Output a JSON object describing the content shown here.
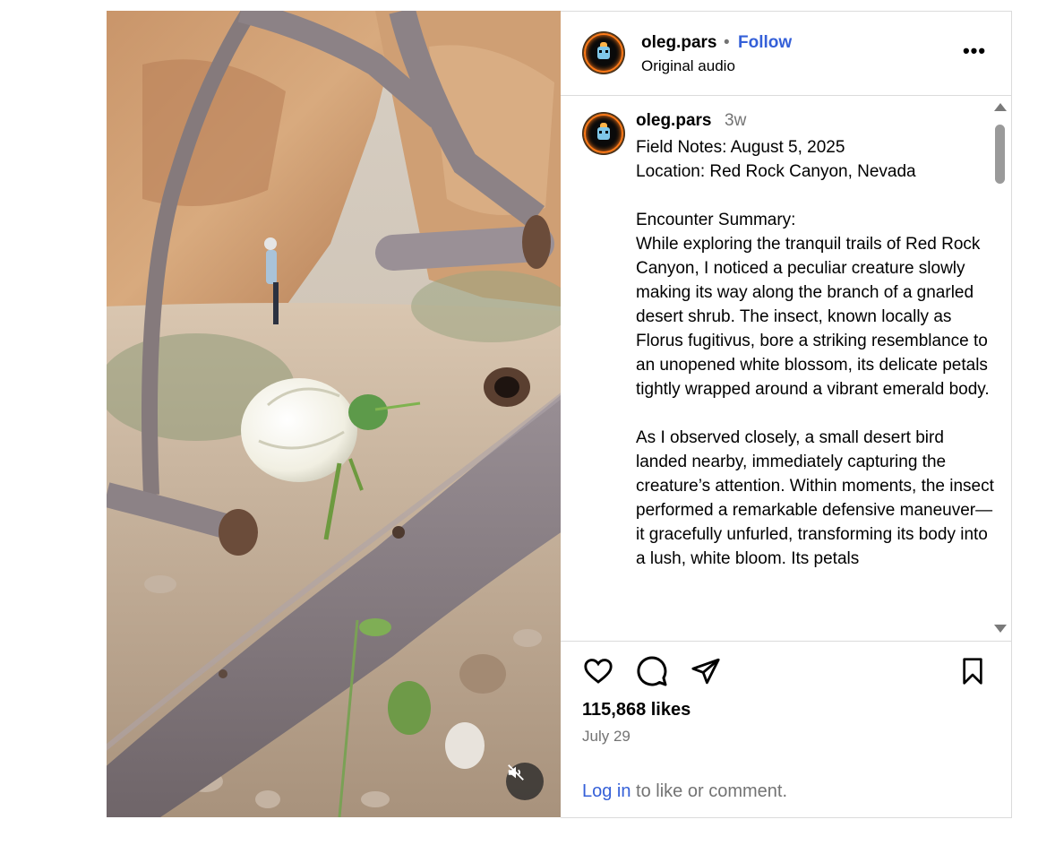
{
  "post": {
    "author": "oleg.pars",
    "separator": "•",
    "follow_label": "Follow",
    "audio_label": "Original audio",
    "more_label": "•••",
    "caption_time": "3w",
    "caption": "Field Notes: August 5, 2025\nLocation: Red Rock Canyon, Nevada\n\nEncounter Summary:\nWhile exploring the tranquil trails of Red Rock Canyon, I noticed a peculiar creature slowly making its way along the branch of a gnarled desert shrub. The insect, known locally as Florus fugitivus, bore a striking resemblance to an unopened white blossom, its delicate petals tightly wrapped around a vibrant emerald body.\n\nAs I observed closely, a small desert bird landed nearby, immediately capturing the creature’s attention. Within moments, the insect performed a remarkable defensive maneuver—it gracefully unfurled, transforming its body into a lush, white bloom. Its petals",
    "likes": "115,868 likes",
    "date": "July 29",
    "login_link": "Log in",
    "login_rest": " to like or comment."
  },
  "icons": {
    "avatar": "robot-avatar-icon",
    "more": "more-options-icon",
    "like": "heart-icon",
    "comment": "comment-icon",
    "share": "share-icon",
    "save": "bookmark-icon",
    "mute": "muted-speaker-icon"
  },
  "colors": {
    "link": "#3560d8",
    "secondary_text": "#737373",
    "border": "#dbdbdb",
    "avatar_ring": "#ff7a18"
  }
}
